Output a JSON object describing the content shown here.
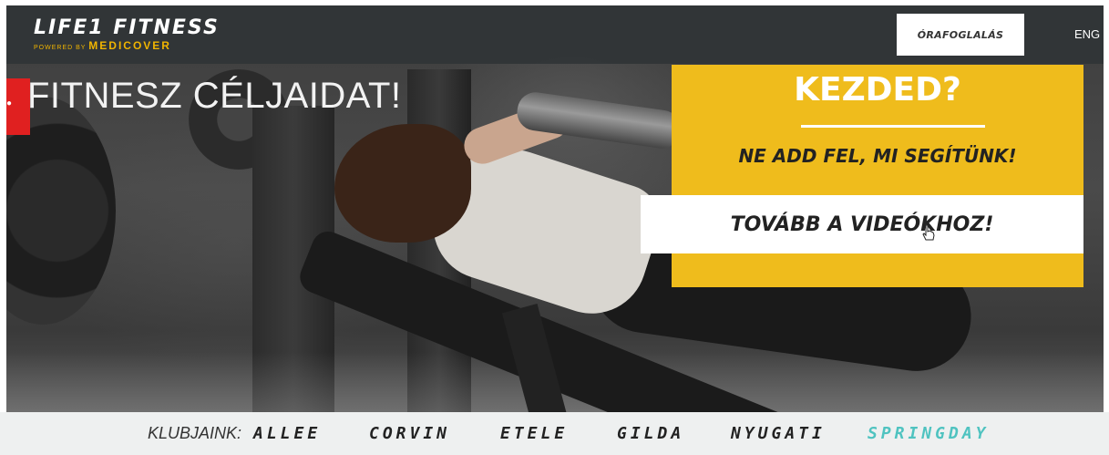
{
  "header": {
    "logo_main": "LIFE1 FITNESS",
    "logo_powered": "POWERED BY",
    "logo_brand": "MEDICOVER",
    "book_button": "ÓRAFOGLALÁS",
    "language": "ENG"
  },
  "hero": {
    "headline": "FITNESZ CÉLJAIDAT!"
  },
  "promo": {
    "title": "KEZDED?",
    "subtitle": "NE ADD FEL, MI SEGÍTÜNK!",
    "cta": "TOVÁBB A VIDEÓKHOZ!"
  },
  "clubs": {
    "label": "KLUBJAINK:",
    "items": [
      "ALLEE",
      "CORVIN",
      "ETELE",
      "GILDA",
      "NYUGATI",
      "SPRINGDAY"
    ]
  },
  "colors": {
    "accent_yellow": "#efbc1c",
    "springday_teal": "#4fc3c0",
    "red_tab": "#e02020"
  }
}
